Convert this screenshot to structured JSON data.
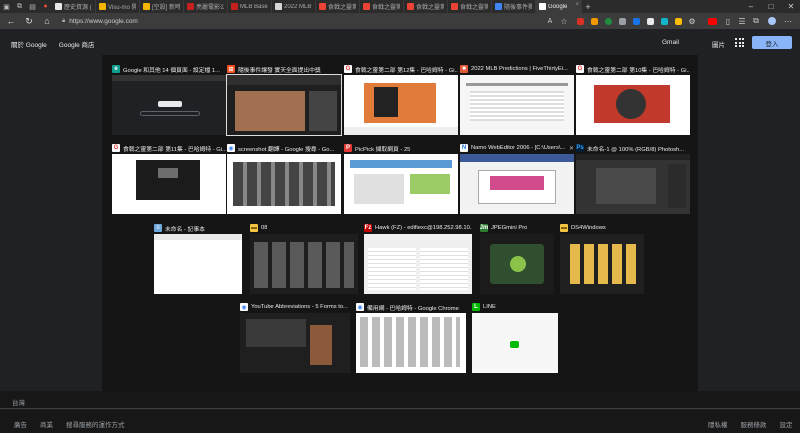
{
  "tabs": [
    {
      "title": "歷史資源 (Go...",
      "color": "#e8e8e8"
    },
    {
      "title": "Visu-mo 開刊...",
      "color": "#f4b400"
    },
    {
      "title": "[空設] 新時尚...",
      "color": "#f4b400"
    },
    {
      "title": "亮麗電影公布...",
      "color": "#c5221f"
    },
    {
      "title": "MLB Baseball...",
      "color": "#c5221f"
    },
    {
      "title": "2022 MLB P...",
      "color": "#d8d8d8"
    },
    {
      "title": "食戟之靈第...",
      "color": "#ea4335"
    },
    {
      "title": "食戟之靈第...",
      "color": "#ea4335"
    },
    {
      "title": "食戟之靈第...",
      "color": "#ea4335"
    },
    {
      "title": "食戟之靈第...",
      "color": "#ea4335"
    },
    {
      "title": "隨後事件獨...",
      "color": "#4285f4"
    },
    {
      "title": "Google",
      "color": "#ffffff"
    }
  ],
  "address": {
    "url": "https://www.google.com"
  },
  "page": {
    "nav_about": "關於 Google",
    "nav_store": "Google 商店",
    "gmail": "Gmail",
    "images": "圖片",
    "signin": "登入",
    "country": "台灣",
    "footer_left": [
      "廣告",
      "商業",
      "搜尋服務的運作方式"
    ],
    "footer_right": [
      "隱私權",
      "服務條款",
      "設定"
    ]
  },
  "cards": [
    {
      "title": "Google 和其他 14 個頁面 - 設定檔 1...",
      "icon": "edge-icon",
      "theme": "dark-google"
    },
    {
      "title": "隨後事件讓發 實天全面提出中獎",
      "icon": "windows-icon",
      "theme": "news"
    },
    {
      "title": "食戟之靈第二部 第12集 - 巴哈姆特 - Gi...",
      "icon": "gamer-icon",
      "theme": "anime"
    },
    {
      "title": "2022 MLB Predictions | FiveThirtyEi...",
      "icon": "fte-icon",
      "theme": "table"
    },
    {
      "title": "食戟之靈第二部 第10集 - 巴哈姆特 - Gi...",
      "icon": "gamer-icon",
      "theme": "anime2"
    },
    {
      "title": "食戟之靈第二部 第11集 - 巴哈姆特 - Gi...",
      "icon": "gamer-icon",
      "theme": "video"
    },
    {
      "title": "screenshot 翻譯 - Google 搜尋 - Go...",
      "icon": "chrome-icon",
      "theme": "search"
    },
    {
      "title": "PicPick 擷取網頁 - 25",
      "icon": "picpick-icon",
      "theme": "picpick"
    },
    {
      "title": "Namo WebEditor 2006 - [C:\\Users\\...",
      "icon": "namo-icon",
      "theme": "editor"
    },
    {
      "title": "未命名-1 @ 100% (RGB/8) Photosh...",
      "icon": "ps-icon",
      "theme": "ps"
    },
    {
      "title": "未命名 - 記事本",
      "icon": "notepad-icon",
      "theme": "notepad"
    },
    {
      "title": "08",
      "icon": "folder-icon",
      "theme": "explorer"
    },
    {
      "title": "Hawk (FZ) - edifiexc@198.252.98.10...",
      "icon": "filezilla-icon",
      "theme": "ftp"
    },
    {
      "title": "JPEGmini Pro",
      "icon": "jpegmini-icon",
      "theme": "jpeg"
    },
    {
      "title": "DS4Windows",
      "icon": "folder-icon",
      "theme": "explorer2"
    },
    {
      "title": "YouTube Abbreviations - 5 Forms to...",
      "icon": "chrome-icon",
      "theme": "youtube"
    },
    {
      "title": "備用網 - 巴哈姆特 - Google Chrome",
      "icon": "chrome-icon",
      "theme": "chrome2"
    },
    {
      "title": "LINE",
      "icon": "line-icon",
      "theme": "line"
    }
  ]
}
